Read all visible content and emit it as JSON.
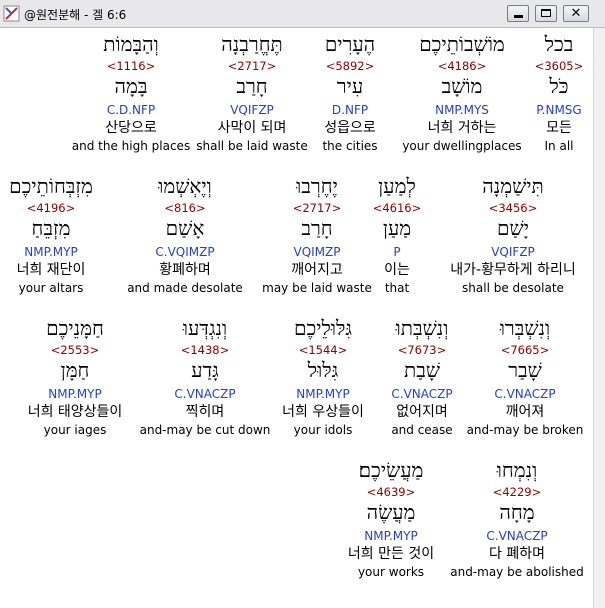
{
  "window": {
    "title": "@원전분해 - 겔 6:6",
    "min_glyph": "_",
    "max_glyph": "□",
    "close_glyph": "✕"
  },
  "rows": [
    {
      "words": [
        {
          "heb": "בכל",
          "strong": "<3605>",
          "lemma": "כֹּל",
          "morph": "P.NMSG",
          "kor": "모든",
          "eng": "In all"
        },
        {
          "heb": "מוֹשְׁבוֹתֵיכֶם",
          "strong": "<4186>",
          "lemma": "מוֹשָׁב",
          "morph": "NMP.MYS",
          "kor": "너희 거하는",
          "eng": "your dwellingplaces"
        },
        {
          "heb": "הֶעָרִים",
          "strong": "<5892>",
          "lemma": "עִיר",
          "morph": "D.NFP",
          "kor": "성읍으로",
          "eng": "the cities"
        },
        {
          "heb": "תֶּחֱרַבְנָה",
          "strong": "<2717>",
          "lemma": "חָרַב",
          "morph": "VQIFZP",
          "kor": "사막이 되며",
          "eng": "shall be laid waste"
        },
        {
          "heb": "וְהַבָּמוֹת",
          "strong": "<1116>",
          "lemma": "בָּמָה",
          "morph": "C.D.NFP",
          "kor": "산당으로",
          "eng": "and the high places"
        }
      ]
    },
    {
      "words": [
        {
          "heb": "תִּישַׁמְנָה",
          "strong": "<3456>",
          "lemma": "יָשַׁם",
          "morph": "VQIFZP",
          "kor": "내가-황무하게 하리니",
          "eng": "shall be desolate"
        },
        {
          "heb": "לְמַעַן",
          "strong": "<4616>",
          "lemma": "מַעַן",
          "morph": "P",
          "kor": "이는",
          "eng": "that"
        },
        {
          "heb": "יֶחֶרְבוּ",
          "strong": "<2717>",
          "lemma": "חָרַב",
          "morph": "VQIMZP",
          "kor": "깨어지고",
          "eng": "may be laid waste"
        },
        {
          "heb": "וְיֶאְשְׁמוּ",
          "strong": "<816>",
          "lemma": "אָשַׁם",
          "morph": "C.VQIMZP",
          "kor": "황폐하며",
          "eng": "and made desolate"
        },
        {
          "heb": "מִזְבְּחוֹתֵיכֶם",
          "strong": "<4196>",
          "lemma": "מִזְבֵּחַ",
          "morph": "NMP.MYP",
          "kor": "너희 재단이",
          "eng": "your altars"
        }
      ]
    },
    {
      "words": [
        {
          "heb": "וְנִשְׁבְּרוּ",
          "strong": "<7665>",
          "lemma": "שָׁבַר",
          "morph": "C.VNACZP",
          "kor": "깨어져",
          "eng": "and-may be broken"
        },
        {
          "heb": "וְנִשְׁבְּתוּ",
          "strong": "<7673>",
          "lemma": "שָׁבַת",
          "morph": "C.VNACZP",
          "kor": "없어지며",
          "eng": "and cease"
        },
        {
          "heb": "גִּלּוּלֵיכֶם",
          "strong": "<1544>",
          "lemma": "גִּלּוּל",
          "morph": "NMP.MYP",
          "kor": "너희 우상들이",
          "eng": "your idols"
        },
        {
          "heb": "וְנִגְדְּעוּ",
          "strong": "<1438>",
          "lemma": "גָּדַע",
          "morph": "C.VNACZP",
          "kor": "찍히며",
          "eng": "and-may be cut down"
        },
        {
          "heb": "חַמָּנֵיכֶם",
          "strong": "<2553>",
          "lemma": "חַמָּן",
          "morph": "NMP.MYP",
          "kor": "너희 태양상들이",
          "eng": "your iages"
        }
      ]
    },
    {
      "words": [
        {
          "heb": "וְנִמְחוּ",
          "strong": "<4229>",
          "lemma": "מָחָה",
          "morph": "C.VNACZP",
          "kor": "다 폐하며",
          "eng": "and-may be abolished"
        },
        {
          "heb": "מַעֲשֵׂיכֶם׃",
          "strong": "<4639>",
          "lemma": "מַעֲשֶׂה",
          "morph": "NMP.MYP",
          "kor": "너희 만든 것이",
          "eng": "your works"
        }
      ]
    }
  ]
}
